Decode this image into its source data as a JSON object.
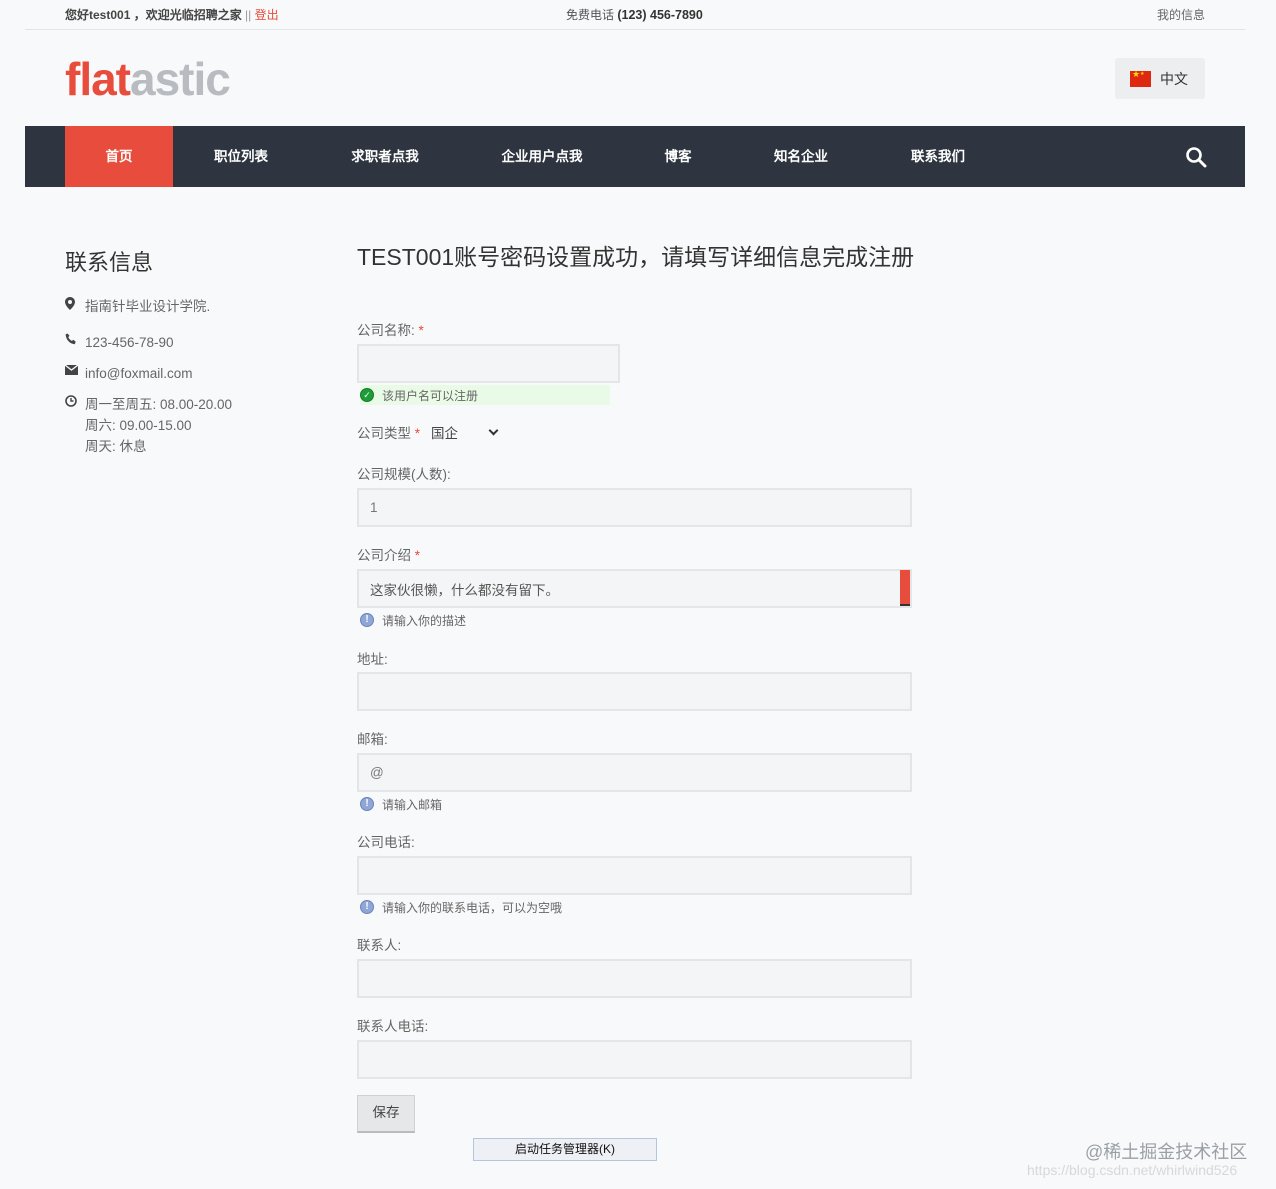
{
  "topbar": {
    "greeting": "您好test001 ，欢迎光临招聘之家",
    "separator": "||",
    "logout": "登出",
    "phone_label": "免费电话",
    "phone_number": "(123) 456-7890",
    "my_info": "我的信息"
  },
  "logo": {
    "part1": "flat",
    "part2": "astic"
  },
  "language": {
    "label": "中文"
  },
  "nav": {
    "items": [
      {
        "label": "首页",
        "active": true
      },
      {
        "label": "职位列表"
      },
      {
        "label": "求职者点我"
      },
      {
        "label": "企业用户点我"
      },
      {
        "label": "博客"
      },
      {
        "label": "知名企业"
      },
      {
        "label": "联系我们"
      }
    ]
  },
  "sidebar": {
    "title": "联系信息",
    "address": "指南针毕业设计学院.",
    "phone": "123-456-78-90",
    "email": "info@foxmail.com",
    "hours": [
      "周一至周五: 08.00-20.00",
      "周六: 09.00-15.00",
      "周天: 休息"
    ]
  },
  "form": {
    "title": "TEST001账号密码设置成功，请填写详细信息完成注册",
    "company_name": {
      "label": "公司名称:",
      "value": "",
      "status": "该用户名可以注册"
    },
    "company_type": {
      "label": "公司类型",
      "value": "国企"
    },
    "company_size": {
      "label": "公司规模(人数):",
      "value": "1"
    },
    "company_intro": {
      "label": "公司介绍",
      "value": "这家伙很懒，什么都没有留下。",
      "hint": "请输入你的描述"
    },
    "address": {
      "label": "地址:",
      "value": ""
    },
    "email": {
      "label": "邮箱:",
      "value": "@",
      "hint": "请输入邮箱"
    },
    "company_phone": {
      "label": "公司电话:",
      "value": "",
      "hint": "请输入你的联系电话，可以为空哦"
    },
    "contact": {
      "label": "联系人:",
      "value": ""
    },
    "contact_phone": {
      "label": "联系人电话:",
      "value": ""
    },
    "required_mark": "*",
    "save_label": "保存"
  },
  "overlay": {
    "task_manager": "启动任务管理器(K)",
    "watermark": "@稀土掘金技术社区",
    "watermark_url": "https://blog.csdn.net/whirlwind526"
  },
  "colors": {
    "accent": "#e74c3c",
    "nav_bg": "#2e3540"
  }
}
